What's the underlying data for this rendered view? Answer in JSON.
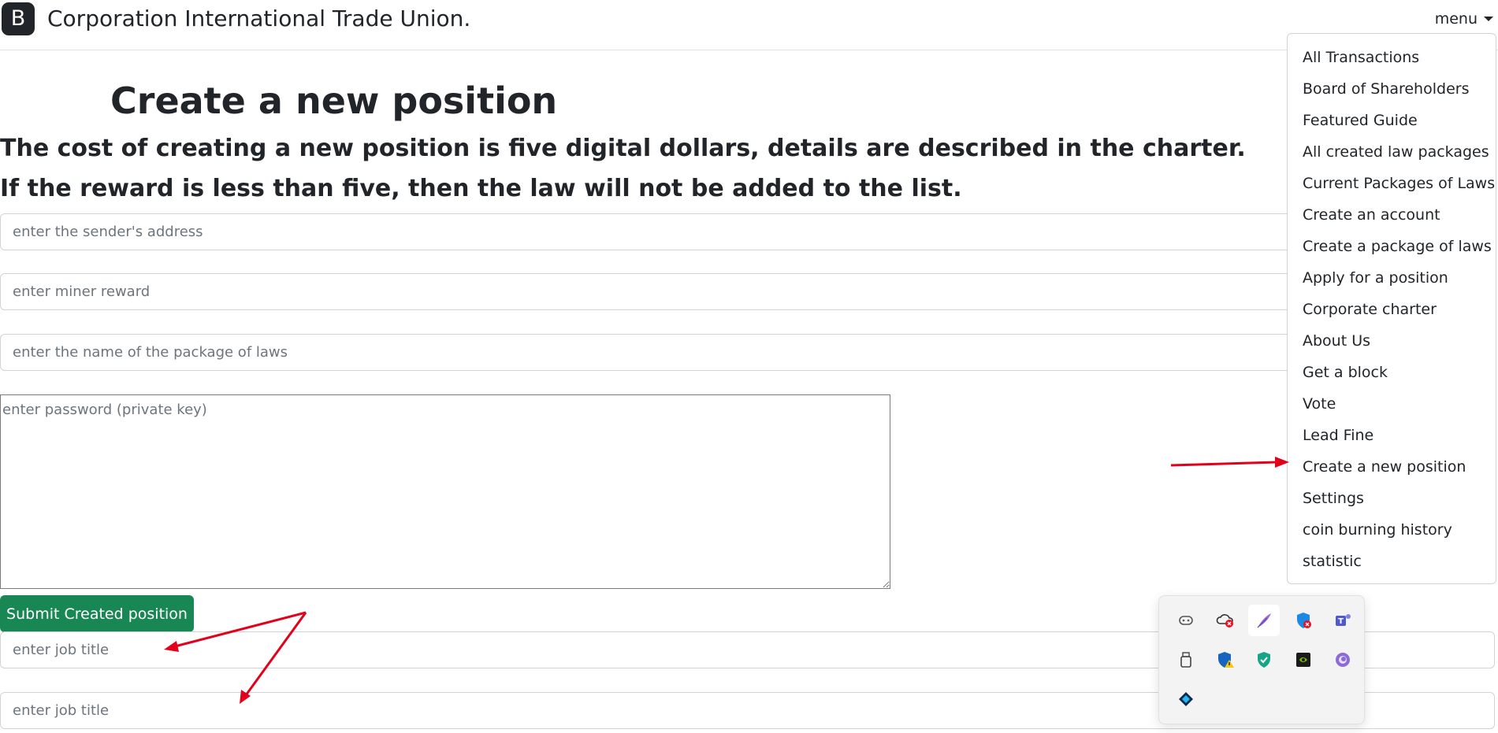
{
  "navbar": {
    "logo_letter": "B",
    "brand": "Corporation International Trade Union.",
    "menu_label": "menu"
  },
  "menu": {
    "items": [
      "All Transactions",
      "Board of Shareholders",
      "Featured Guide",
      "All created law packages",
      "Current Packages of Laws",
      "Create an account",
      "Create a package of laws",
      "Apply for a position",
      "Corporate charter",
      "About Us",
      "Get a block",
      "Vote",
      "Lead Fine",
      "Create a new position",
      "Settings",
      "coin burning history",
      "statistic"
    ]
  },
  "page": {
    "title": "Create a new position",
    "cost_text": "The cost of creating a new position is five digital dollars, details are described in the charter.",
    "reward_text": "If the reward is less than five, then the law will not be added to the list."
  },
  "form": {
    "sender_placeholder": "enter the sender's address",
    "reward_placeholder": "enter miner reward",
    "package_placeholder": "enter the name of the package of laws",
    "password_placeholder": "enter password (private key)",
    "submit_label": "Submit Created position",
    "job_title_placeholder": "enter job title"
  },
  "tray": {
    "icons": [
      "gamepad-icon",
      "cloud-error-icon",
      "feather-icon",
      "shield-error-icon",
      "teams-icon",
      "usb-drive-icon",
      "defender-warning-icon",
      "security-shield-icon",
      "nvidia-icon",
      "firefox-icon",
      "diamond-app-icon"
    ]
  },
  "colors": {
    "primary_text": "#212529",
    "submit_green": "#198754",
    "annotation_red": "#e3001b"
  }
}
